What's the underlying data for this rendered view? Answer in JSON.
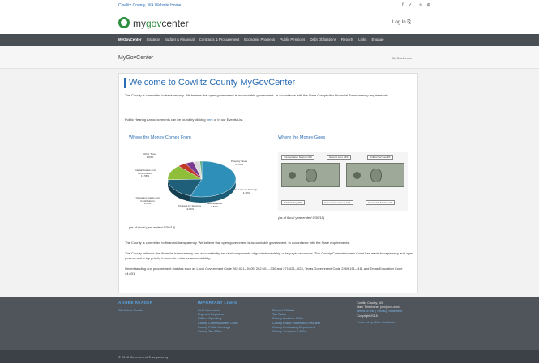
{
  "topbar": {
    "home_link": "Cowlitz County, WA Website Home",
    "social": "f ✓ in ⊕"
  },
  "brand": {
    "logo_prefix": "my",
    "logo_highlight": "gov",
    "logo_suffix": "center",
    "login": "Log In ⎘"
  },
  "nav": {
    "items": [
      "MyGovCenter",
      "Strategy",
      "Budget & Financial",
      "Contracts & Procurement",
      "Economic Progress",
      "Public Pensions",
      "Debt Obligations",
      "Reports",
      "Links",
      "Engage"
    ]
  },
  "page": {
    "title": "MyGovCenter",
    "breadcrumb": "MyGovCenter"
  },
  "welcome": {
    "heading": "Welcome to Cowlitz County MyGovCenter",
    "intro": "The County is committed to transparency. We believe that open government is accountable government. In accordance with the State Comptroller Financial Transparency requirements.",
    "hearing_before": "Public Hearing Announcements can be found by clicking",
    "hearing_link": "here",
    "hearing_after": "or in our Events List."
  },
  "sources": {
    "heading": "Where the Money Comes From",
    "caption": "(as of fiscal year ended 9/30/18)",
    "labels": [
      {
        "name": "Other Taxes",
        "pct": "3.84%"
      },
      {
        "name": "Property Taxes",
        "pct": "55.35%"
      },
      {
        "name": "Capital Grants and Contributions",
        "pct": "13.58%"
      },
      {
        "name": "Operating Grants and Contributions",
        "pct": "3.26%"
      },
      {
        "name": "Charges for Services",
        "pct": "19.04%"
      },
      {
        "name": "Miscellaneous",
        "pct": "0.82%"
      },
      {
        "name": "Investment Earnings",
        "pct": "4.10%"
      }
    ]
  },
  "uses": {
    "heading": "Where the Money Goes",
    "caption": "(as of fiscal year ended 9/30/18)",
    "tags": [
      "Transportation Support 19%",
      "General Govt. 14%",
      "Judicial Services 9%",
      "Public Safety 32%",
      "General Government 12%",
      "Community Services 7%"
    ]
  },
  "body": {
    "p1": "The County is committed to financial transparency. We believe that open government is accountable government. In accordance with the State requirements.",
    "p2": "The County believes that financial transparency and accountability are vital components of good stewardship of taxpayer resources. The County Commissioner's Court has made transparency and open government a top priority in order to enhance accountability.",
    "p3": "Understanding and procurement statutes such as Local Government Code 262.021–.0405, 262.001–.030 and 271.021–.023, Texas Government Code 2269.151–.411 and Texas Education Code 44.031."
  },
  "footer": {
    "adobe_heading": "ADOBE READER",
    "adobe_link": "Get Adobe Reader",
    "links_heading": "IMPORTANT LINKS",
    "links_col1": [
      "Debt Information",
      "Payment Registers",
      "Utilities Spending",
      "County Commissioners Court",
      "County Public Meetings",
      "County Tax Office"
    ],
    "links_col2": [
      "Elected Officials",
      "Tax Rates",
      "County Auditor's Office",
      "County Public Information Request",
      "County Purchasing Department",
      "County Treasurer's Office"
    ],
    "contact": [
      "Cowlitz County, WA",
      "Main Telephone: (xxx) xxx-xxxx",
      "Terms of Use | Privacy Statement",
      "Copyright 2018"
    ],
    "powered": "Powered by Mitrix Solutions",
    "copyright": "© 2018 Government Transparency"
  },
  "chart_data": {
    "type": "pie",
    "title": "Where the Money Comes From",
    "labels": [
      "Property Taxes",
      "Charges for Services",
      "Capital Grants and Contributions",
      "Investment Earnings",
      "Other Taxes",
      "Operating Grants and Contributions",
      "Miscellaneous"
    ],
    "values": [
      55.35,
      19.04,
      13.58,
      4.1,
      3.84,
      3.26,
      0.82
    ],
    "colors": [
      "#2e8fb8",
      "#1f5f7a",
      "#8fbf3a",
      "#c0392b",
      "#7a3b8f",
      "#d9d9d9",
      "#3d9e6a"
    ]
  }
}
